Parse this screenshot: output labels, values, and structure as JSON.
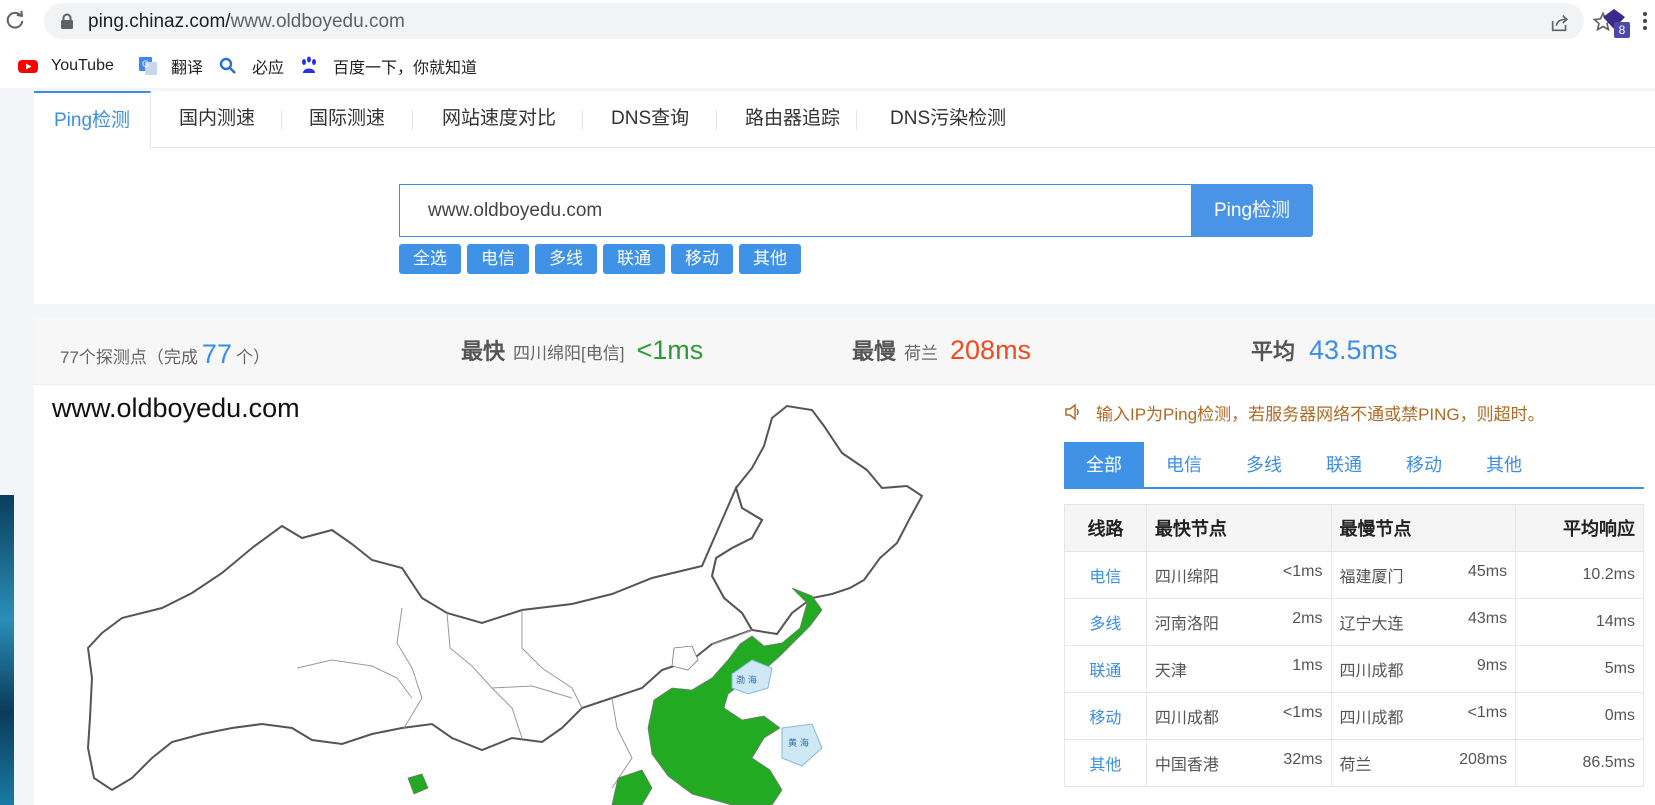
{
  "browser": {
    "url_host": "ping.chinaz.com/",
    "url_path": "www.oldboyedu.com",
    "extension_badge": "8"
  },
  "bookmarks": [
    {
      "label": "YouTube",
      "icon": "youtube-icon"
    },
    {
      "label": "翻译",
      "icon": "translate-icon"
    },
    {
      "label": "必应",
      "icon": "search-icon"
    },
    {
      "label": "百度一下，你就知道",
      "icon": "baidu-icon"
    }
  ],
  "nav_tabs": [
    "Ping检测",
    "国内测速",
    "国际测速",
    "网站速度对比",
    "DNS查询",
    "路由器追踪",
    "DNS污染检测"
  ],
  "search": {
    "value": "www.oldboyedu.com",
    "button": "Ping检测",
    "filters": [
      "全选",
      "电信",
      "多线",
      "联通",
      "移动",
      "其他"
    ]
  },
  "summary": {
    "probe_prefix": "77个探测点（完成",
    "probe_count": "77",
    "probe_suffix": "个）",
    "fastest_label": "最快",
    "fastest_loc": "四川绵阳[电信]",
    "fastest_value": "<1ms",
    "slowest_label": "最慢",
    "slowest_loc": "荷兰",
    "slowest_value": "208ms",
    "avg_label": "平均",
    "avg_value": "43.5ms"
  },
  "map": {
    "title": "www.oldboyedu.com",
    "label_bohai": "渤 海",
    "label_huanghai": "黄 海"
  },
  "notice": "输入IP为Ping检测，若服务器网络不通或禁PING，则超时。",
  "isp_tabs": [
    "全部",
    "电信",
    "多线",
    "联通",
    "移动",
    "其他"
  ],
  "table": {
    "headers": [
      "线路",
      "最快节点",
      "最慢节点",
      "平均响应"
    ],
    "rows": [
      {
        "isp": "电信",
        "fast_node": "四川绵阳",
        "fast_ms": "<1ms",
        "slow_node": "福建厦门",
        "slow_ms": "45ms",
        "avg": "10.2ms"
      },
      {
        "isp": "多线",
        "fast_node": "河南洛阳",
        "fast_ms": "2ms",
        "slow_node": "辽宁大连",
        "slow_ms": "43ms",
        "avg": "14ms"
      },
      {
        "isp": "联通",
        "fast_node": "天津",
        "fast_ms": "1ms",
        "slow_node": "四川成都",
        "slow_ms": "9ms",
        "avg": "5ms"
      },
      {
        "isp": "移动",
        "fast_node": "四川成都",
        "fast_ms": "<1ms",
        "slow_node": "四川成都",
        "slow_ms": "<1ms",
        "avg": "0ms"
      },
      {
        "isp": "其他",
        "fast_node": "中国香港",
        "fast_ms": "32ms",
        "slow_node": "荷兰",
        "slow_ms": "208ms",
        "avg": "86.5ms"
      }
    ]
  },
  "colors": {
    "accent": "#3a8ee6",
    "fast": "#2e9a36",
    "slow": "#f04a1e",
    "map_fill": "#22aa22"
  }
}
